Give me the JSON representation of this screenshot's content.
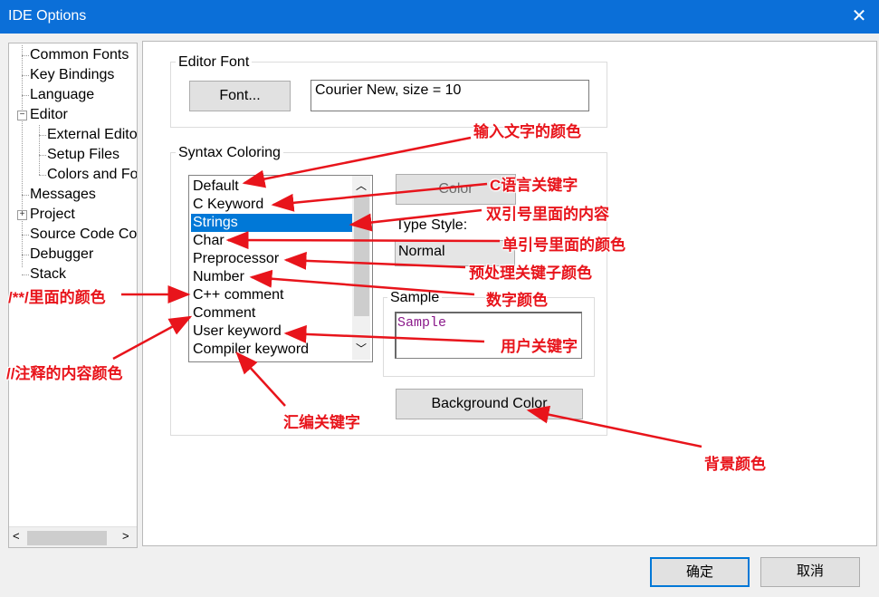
{
  "window": {
    "title": "IDE Options",
    "close_glyph": "✕"
  },
  "tree": {
    "items": [
      {
        "label": "Common Fonts"
      },
      {
        "label": "Key Bindings"
      },
      {
        "label": "Language"
      },
      {
        "label": "Editor"
      },
      {
        "label": "External Edito"
      },
      {
        "label": "Setup Files"
      },
      {
        "label": "Colors and Fo"
      },
      {
        "label": "Messages"
      },
      {
        "label": "Project"
      },
      {
        "label": "Source Code Co"
      },
      {
        "label": "Debugger"
      },
      {
        "label": "Stack"
      }
    ],
    "collapse_glyph": "−",
    "expand_glyph": "+",
    "scroll_left": "<",
    "scroll_right": ">"
  },
  "editor_font": {
    "group_title": "Editor Font",
    "font_button": "Font...",
    "font_value": "Courier New, size = 10"
  },
  "syntax": {
    "group_title": "Syntax Coloring",
    "items": [
      "Default",
      "C Keyword",
      "Strings",
      "Char",
      "Preprocessor",
      "Number",
      "C++ comment",
      "Comment",
      "User keyword",
      "Compiler keyword"
    ],
    "selected": "Strings",
    "scroll_up": "︿",
    "scroll_down": "﹀",
    "color_button": "Color",
    "type_style_label": "Type Style:",
    "type_style_value": "Normal",
    "sample_title": "Sample",
    "sample_text": "Sample",
    "sample_color": "#8b1a8b",
    "background_button": "Background Color"
  },
  "annotations": {
    "input_text_color": "输入文字的颜色",
    "c_keyword": "C语言关键字",
    "string_content": "双引号里面的内容",
    "char_color": "单引号里面的颜色",
    "preprocessor": "预处理关键子颜色",
    "number_color": "数字颜色",
    "block_comment": "/**/里面的颜色",
    "line_comment": "//注释的内容颜色",
    "user_keyword": "用户关键字",
    "compiler_keyword": "汇编关键字",
    "background_color": "背景颜色"
  },
  "footer": {
    "ok": "确定",
    "cancel": "取消"
  },
  "colors": {
    "title_bar": "#0b6fd8",
    "selection": "#0078d7",
    "annotation": "#e8141b"
  }
}
